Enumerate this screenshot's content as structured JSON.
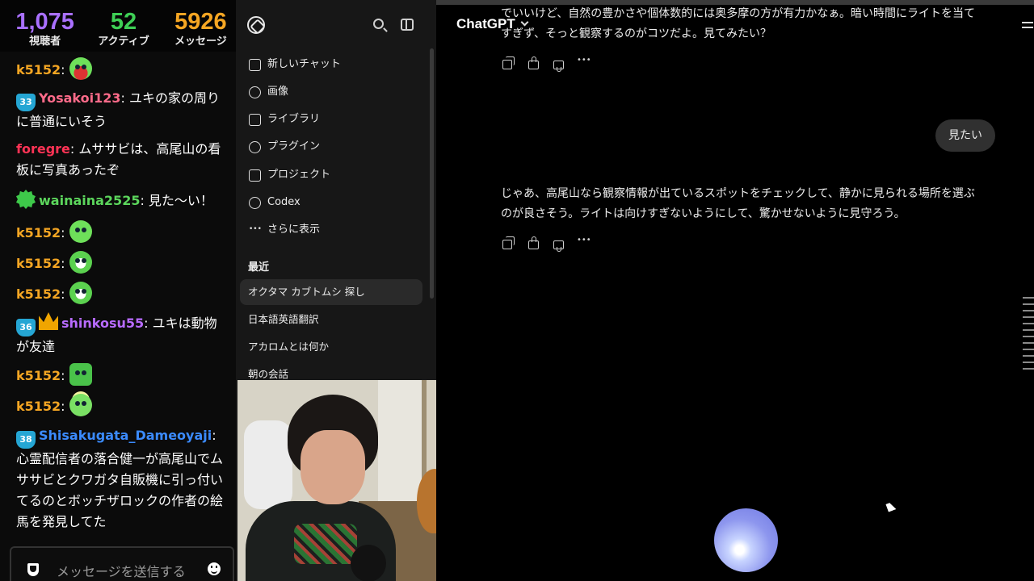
{
  "stream_stats": {
    "viewers": {
      "value": "1,075",
      "label": "視聴者",
      "color": "#a970ff"
    },
    "active": {
      "value": "52",
      "label": "アクティブ",
      "color": "#3ecf55"
    },
    "messages": {
      "value": "5926",
      "label": "メッセージ",
      "color": "#f5a623"
    }
  },
  "chat_messages": [
    {
      "user": "k5152",
      "sep": ":",
      "text": "",
      "user_color": "#f5a623",
      "emote": "red-mouth-emote"
    },
    {
      "badge": "33",
      "user": "Yosakoi123",
      "sep": ":",
      "text": " ユキの家の周りに普通にいそう",
      "user_color": "#ff6b8a"
    },
    {
      "user": "foregre",
      "sep": ":",
      "text": " ムササビは、高尾山の看板に写真あったぞ",
      "user_color": "#ff3355"
    },
    {
      "user": "wainaina2525",
      "sep": ":",
      "text": " 見た〜い！",
      "user_color": "#5cd65c",
      "verified": true
    },
    {
      "user": "k5152",
      "sep": ":",
      "text": "",
      "user_color": "#f5a623",
      "emote": "green-emote"
    },
    {
      "user": "k5152",
      "sep": ":",
      "text": "",
      "user_color": "#f5a623",
      "emote": "mask-emote"
    },
    {
      "user": "k5152",
      "sep": ":",
      "text": "",
      "user_color": "#f5a623",
      "emote": "mask-emote"
    },
    {
      "badge": "36",
      "crown": true,
      "user": "shinkosu55",
      "sep": ":",
      "text": " ユキは動物が友達",
      "user_color": "#b86bff"
    },
    {
      "user": "k5152",
      "sep": ":",
      "text": "",
      "user_color": "#f5a623",
      "emote": "grin-emote"
    },
    {
      "user": "k5152",
      "sep": ":",
      "text": "",
      "user_color": "#f5a623",
      "emote": "halo-emote"
    },
    {
      "badge": "38",
      "user": "Shisakugata_Dameoyaji",
      "sep": ":",
      "text": " 心霊配信者の落合健一が高尾山でムササビとクワガタ自販機に引っ付いてるのとボッチザロックの作者の絵馬を発見してた",
      "user_color": "#3b8bff"
    }
  ],
  "chat_input": {
    "placeholder": "メッセージを送信する"
  },
  "sidebar": {
    "nav": [
      {
        "label": "新しいチャット",
        "icon": "edit-icon"
      },
      {
        "label": "画像",
        "icon": "image-icon"
      },
      {
        "label": "ライブラリ",
        "icon": "library-icon"
      },
      {
        "label": "プラグイン",
        "icon": "plugin-icon"
      },
      {
        "label": "プロジェクト",
        "icon": "folder-icon"
      },
      {
        "label": "Codex",
        "icon": "codex-icon"
      },
      {
        "label": "さらに表示",
        "icon": "more-icon"
      }
    ],
    "recent_heading": "最近",
    "recent_chats": [
      "オクタマ カブトムシ 探し",
      "日本語英語翻訳",
      "アカロムとは何か",
      "朝の会話"
    ]
  },
  "main": {
    "model": "ChatGPT",
    "assistant_msg_1": "でいいけど、自然の豊かさや個体数的には奥多摩の方が有力かなぁ。暗い時間にライトを当てすぎず、そっと観察するのがコツだよ。見てみたい？",
    "user_msg": "見たい",
    "assistant_msg_2": "じゃあ、高尾山なら観察情報が出ているスポットをチェックして、静かに見られる場所を選ぶのが良さそう。ライトは向けすぎないようにして、驚かせないように見守ろう。"
  }
}
